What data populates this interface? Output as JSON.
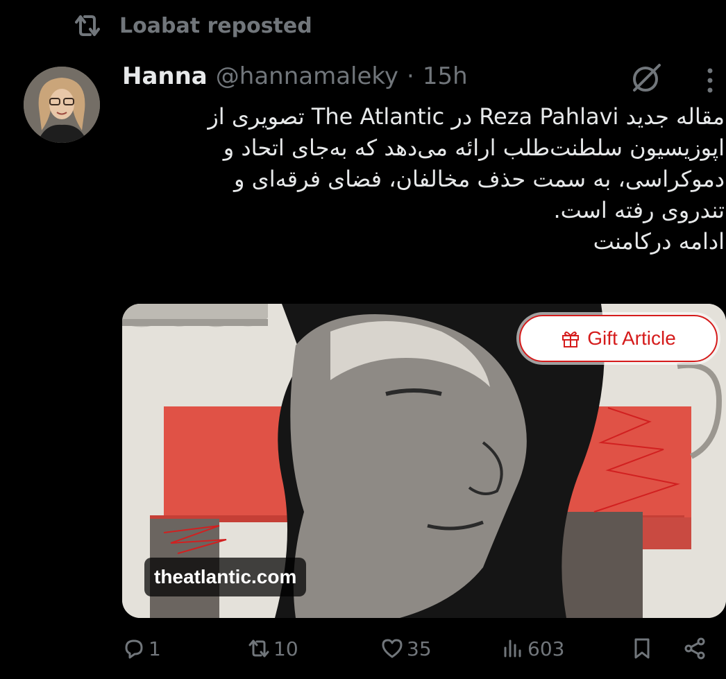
{
  "repost": {
    "icon": "repost-icon",
    "label": "Loabat reposted"
  },
  "author": {
    "name": "Hanna",
    "handle": "@hannamaleky",
    "separator": "·",
    "time": "15h"
  },
  "tweet": {
    "lines": [
      "مقاله جدید Reza Pahlavi در The Atlantic تصویری از",
      "اپوزیسیون سلطنت‌طلب ارائه می‌دهد که به‌جای اتحاد و",
      "دموکراسی، به سمت حذف مخالفان، فضای فرقه‌ای و",
      "تندروی رفته است.",
      "ادامه درکامنت"
    ]
  },
  "card": {
    "gift_label": "Gift Article",
    "gift_icon": "gift-icon",
    "domain": "theatlantic.com",
    "accent_color": "#d51b1b"
  },
  "actions": {
    "replies": "1",
    "reposts": "10",
    "likes": "35",
    "views": "603"
  },
  "colors": {
    "background": "#000000",
    "text": "#e7e9ea",
    "muted": "#71767b"
  }
}
